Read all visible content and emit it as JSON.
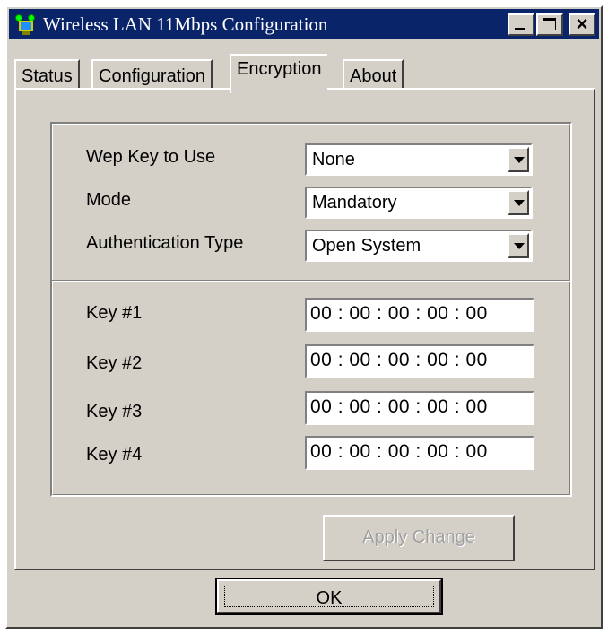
{
  "window": {
    "title": "Wireless LAN 11Mbps Configuration",
    "icon": "wireless-adapter-icon",
    "controls": {
      "minimize": "minimize-icon",
      "maximize": "maximize-icon",
      "close": "×"
    }
  },
  "tabs": [
    {
      "label": "Status",
      "active": false
    },
    {
      "label": "Configuration",
      "active": false
    },
    {
      "label": "Encryption",
      "active": true
    },
    {
      "label": "About",
      "active": false
    }
  ],
  "encryption": {
    "wep_key_label": "Wep Key to Use",
    "wep_key_value": "None",
    "mode_label": "Mode",
    "mode_value": "Mandatory",
    "auth_label": "Authentication Type",
    "auth_value": "Open System",
    "keys": [
      {
        "label": "Key #1",
        "value": "00 : 00 : 00 : 00 : 00"
      },
      {
        "label": "Key #2",
        "value": "00 : 00 : 00 : 00 : 00"
      },
      {
        "label": "Key #3",
        "value": "00 : 00 : 00 : 00 : 00"
      },
      {
        "label": "Key #4",
        "value": "00 : 00 : 00 : 00 : 00"
      }
    ],
    "apply_label": "Apply Change"
  },
  "footer": {
    "ok_label": "OK"
  },
  "colors": {
    "face": "#d4d0c8",
    "titlebar": "#0a246a",
    "disabled_text": "#a0a0a0"
  }
}
